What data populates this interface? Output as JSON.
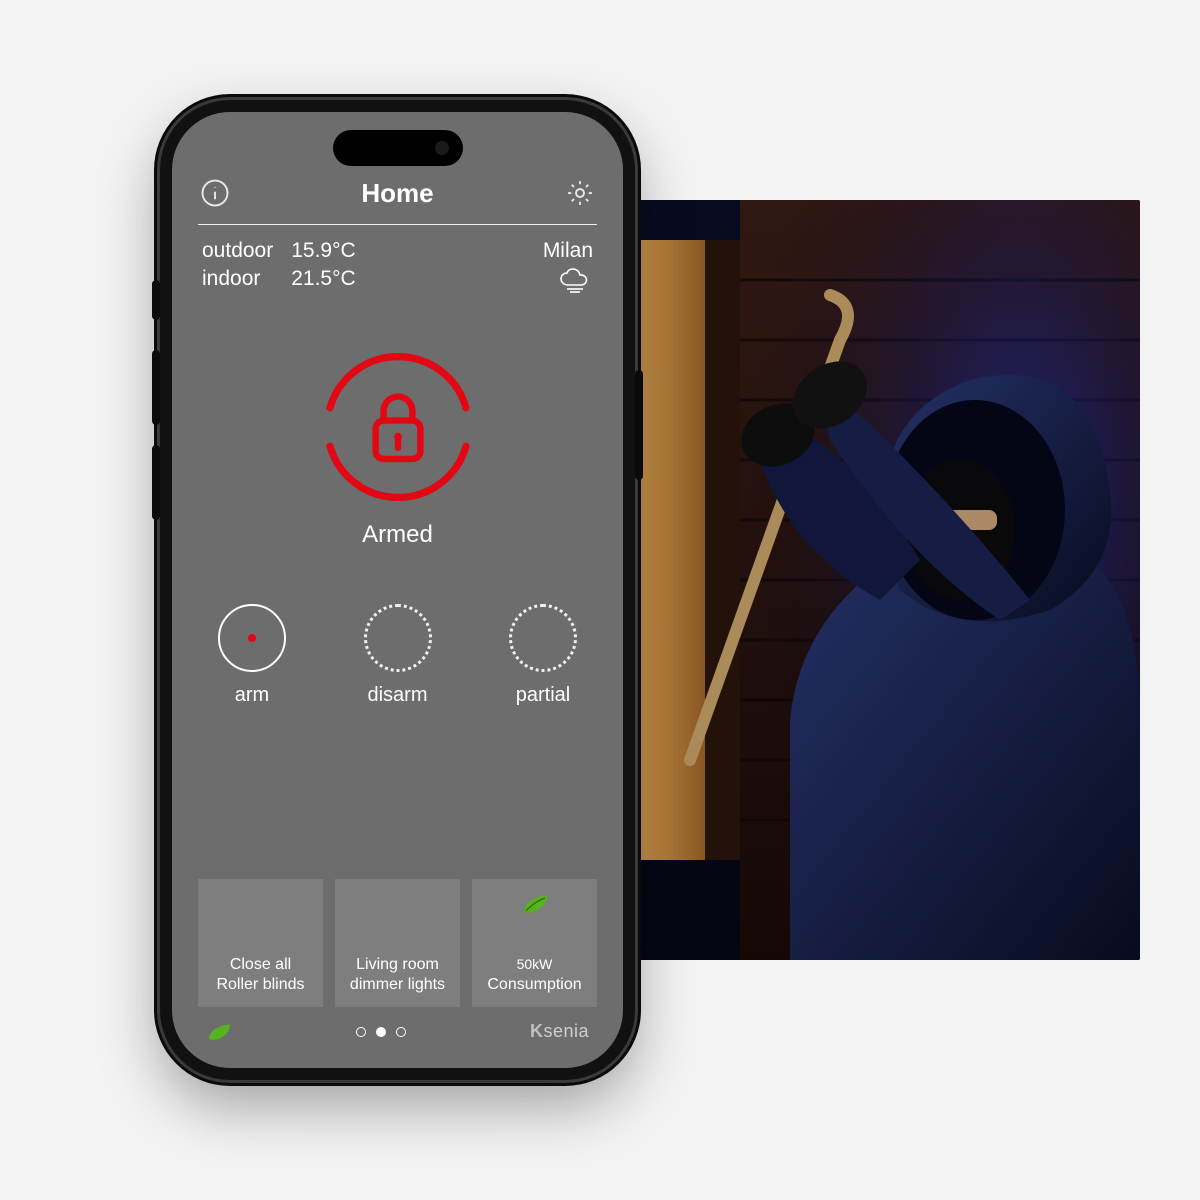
{
  "header": {
    "title": "Home"
  },
  "weather": {
    "outdoor_label": "outdoor",
    "outdoor_value": "15.9°C",
    "indoor_label": "indoor",
    "indoor_value": "21.5°C",
    "location": "Milan"
  },
  "status": {
    "label": "Armed",
    "accent_color": "#e30613"
  },
  "controls": [
    {
      "label": "arm",
      "style": "solid-dot"
    },
    {
      "label": "disarm",
      "style": "dotted"
    },
    {
      "label": "partial",
      "style": "dotted"
    }
  ],
  "tiles": [
    {
      "line1": "Close all",
      "line2": "Roller blinds"
    },
    {
      "line1": "Living room",
      "line2": "dimmer lights"
    },
    {
      "lead": "50kW",
      "line2": "Consumption",
      "icon": "leaf"
    }
  ],
  "brand": "Ksenia",
  "pager": {
    "count": 3,
    "active": 1
  }
}
